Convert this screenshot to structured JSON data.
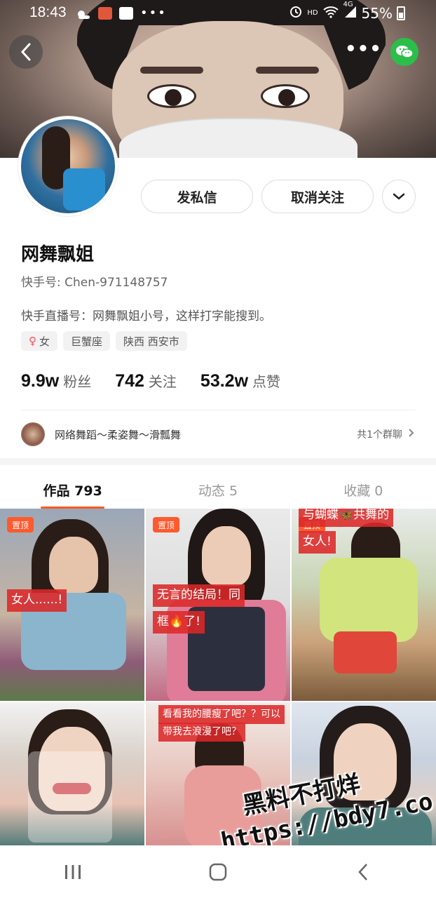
{
  "status_bar": {
    "time": "18:43",
    "hd": "HD",
    "network": "4G",
    "battery": "55%"
  },
  "profile": {
    "name": "网舞飘姐",
    "kuaishou_id": "快手号: Chen-971148757",
    "bio": "快手直播号：网舞飘姐小号，这样打字能搜到。",
    "tags": {
      "gender": "女",
      "zodiac": "巨蟹座",
      "location": "陕西 西安市"
    },
    "stats": {
      "fans_num": "9.9w",
      "fans_label": "粉丝",
      "following_num": "742",
      "following_label": "关注",
      "likes_num": "53.2w",
      "likes_label": "点赞"
    }
  },
  "actions": {
    "message": "发私信",
    "unfollow": "取消关注"
  },
  "group": {
    "title": "网络舞蹈～柔姿舞～滑瓢舞",
    "count": "共1个群聊"
  },
  "tabs": {
    "works": "作品 793",
    "moments": "动态 5",
    "favorites": "收藏 0"
  },
  "grid": {
    "pin_label": "置顶",
    "t1_caption": "女人......!",
    "t2_caption_l1": "无言的结局！同",
    "t2_caption_l2": "框🔥了!",
    "t3_caption_l1": "与蝴蝶🦋共舞的",
    "t3_caption_l2": "女人!",
    "t5_caption_l1": "看看我的腰瘦了吧？？可以",
    "t5_caption_l2": "带我去浪漫了吧？"
  },
  "watermark": {
    "line1": "黑料不打烊",
    "line2": "https://bdy7.co"
  },
  "colors": {
    "accent": "#ff5a1f",
    "pin_badge": "#fe5a2e",
    "wechat": "#2bbf4a",
    "caption_bg": "#dc2828"
  }
}
